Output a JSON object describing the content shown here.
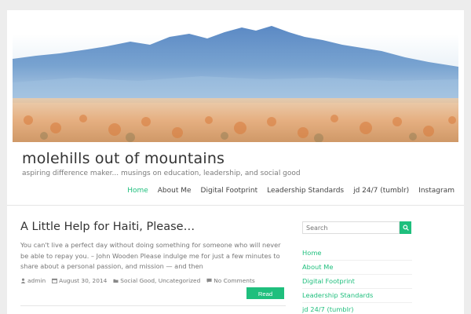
{
  "header": {
    "site_title": "molehills out of mountains",
    "tagline": "aspiring difference maker... musings on education, leadership, and social good",
    "banner_image": "watercolor-mountain-landscape"
  },
  "nav": {
    "items": [
      {
        "label": "Home",
        "active": true
      },
      {
        "label": "About Me",
        "active": false
      },
      {
        "label": "Digital Footprint",
        "active": false
      },
      {
        "label": "Leadership Standards",
        "active": false
      },
      {
        "label": "jd 24/7 (tumblr)",
        "active": false
      },
      {
        "label": "Instagram",
        "active": false
      }
    ]
  },
  "post": {
    "title": "A Little Help for Haiti, Please…",
    "excerpt": "You can't live a perfect day without doing something for someone who will never be able to repay you. – John Wooden Please indulge me for just a few minutes to share about a personal passion, and mission — and then",
    "author": "admin",
    "date": "August 30, 2014",
    "categories": "Social Good, Uncategorized",
    "comments": "No Comments",
    "read_more": "Read more"
  },
  "sidebar": {
    "search_placeholder": "Search",
    "links": [
      "Home",
      "About Me",
      "Digital Footprint",
      "Leadership Standards",
      "jd 24/7 (tumblr)"
    ]
  },
  "colors": {
    "accent": "#1fbf7d",
    "background": "#ededed",
    "text": "#333333"
  },
  "icons": {
    "author": "user-icon",
    "date": "calendar-icon",
    "category": "folder-icon",
    "comments": "comment-icon",
    "search": "search-icon"
  }
}
